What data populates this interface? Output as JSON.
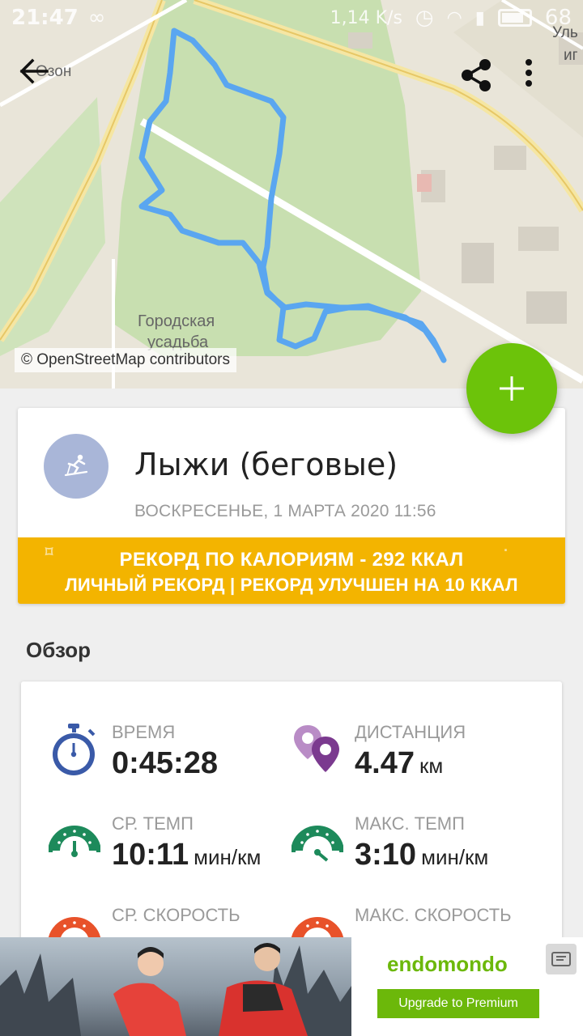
{
  "status_bar": {
    "time": "21:47",
    "net_speed": "1,14 K/s",
    "battery": "68"
  },
  "map": {
    "labels": {
      "ozon": "Озон",
      "street": "Уль",
      "street2": "иг",
      "estate_line1": "Городская",
      "estate_line2": "усадьба"
    },
    "attribution": "© OpenStreetMap contributors",
    "route_color": "#5aa6f0"
  },
  "toolbar": {
    "back_icon": "arrow-left-icon",
    "share_icon": "share-icon",
    "more_icon": "more-vert-icon"
  },
  "workout": {
    "sport_icon": "cross-country-ski-icon",
    "title": "Лыжи (беговые)",
    "date": "ВОСКРЕСЕНЬЕ, 1 МАРТА 2020 11:56",
    "record": {
      "line1": "РЕКОРД ПО КАЛОРИЯМ  -  292 ККАЛ",
      "line2": "ЛИЧНЫЙ РЕКОРД  |  РЕКОРД УЛУЧШЕН НА 10 ККАЛ"
    }
  },
  "overview": {
    "title": "Обзор",
    "stats": [
      {
        "label": "ВРЕМЯ",
        "value": "0:45:28",
        "unit": "",
        "icon": "stopwatch-icon"
      },
      {
        "label": "ДИСТАНЦИЯ",
        "value": "4.47",
        "unit": "км",
        "icon": "location-pins-icon"
      },
      {
        "label": "СР. ТЕМП",
        "value": "10:11",
        "unit": "мин/км",
        "icon": "speedometer-icon"
      },
      {
        "label": "МАКС. ТЕМП",
        "value": "3:10",
        "unit": "мин/км",
        "icon": "speedometer-icon"
      },
      {
        "label": "СР. СКОРОСТЬ",
        "value": "",
        "unit": "",
        "icon": "speedometer-icon"
      },
      {
        "label": "МАКС. СКОРОСТЬ",
        "value": "",
        "unit": "",
        "icon": "speedometer-icon"
      }
    ]
  },
  "ad": {
    "brand": "endomondo",
    "cta": "Upgrade to Premium"
  },
  "colors": {
    "accent_green": "#6cc30a",
    "record_yellow": "#f3b400",
    "timer_blue": "#3a5aa8",
    "pins_purple": "#7b3a8f",
    "pace_green": "#1d8a5b",
    "speed_orange": "#e8522a"
  }
}
